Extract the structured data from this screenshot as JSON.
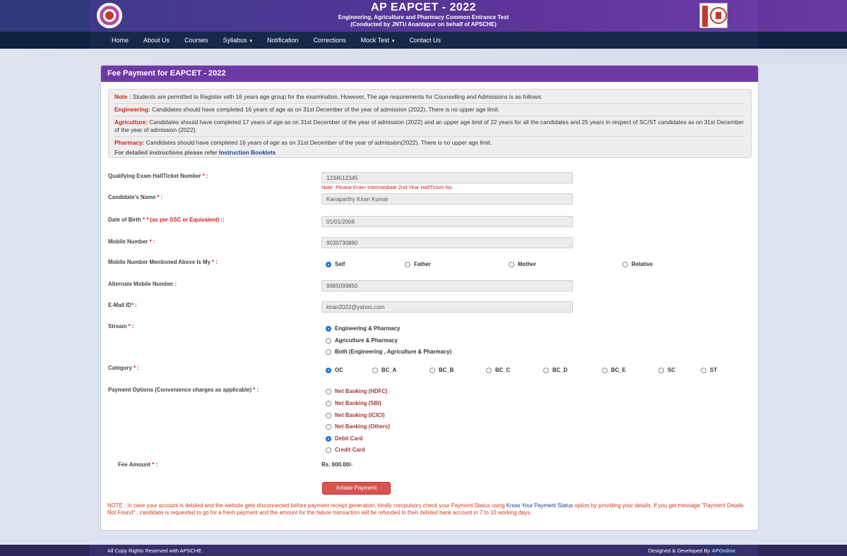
{
  "header": {
    "title": "AP EAPCET - 2022",
    "subtitle1": "Engineering, Agriculture and Pharmacy Common Entrance Test",
    "subtitle2": "(Conducted by JNTU Anantapur on behalf of APSCHE)"
  },
  "nav": {
    "items": [
      "Home",
      "About Us",
      "Courses",
      "Syllabus",
      "Notification",
      "Corrections",
      "Mock Test",
      "Contact Us"
    ]
  },
  "panel": {
    "title": "Fee Payment for EAPCET - 2022"
  },
  "notes": {
    "note_label": "Note :",
    "note_text": " Students are permitted to Register with 16 years age group for the examination. However, The age requirements for Counselling and Admissions is as follows:",
    "eng_label": "Engineering:",
    "eng_text": " Candidates should have completed 16 years of age as on 31st December of the year of admission (2022). There is no upper age limit.",
    "agri_label": "Agriculture:",
    "agri_text": " Candidates should have completed 17 years of age as on 31st December of the year of admission (2022) and an upper age limit of 22 years for all the candidates and 25 years in respect of SC/ST candidates as on 31st December of the year of admission (2022).",
    "pharm_label": "Pharmacy:",
    "pharm_text": " Candidates should have completed 16 years of age as on 31st December of the year of admission(2022). There is no upper age limit.",
    "instr_text": "For detailed instructions please refer ",
    "instr_link": "Instruction Booklets"
  },
  "form": {
    "hallticket_label": "Qualifying Exam HallTicket Number",
    "hallticket_value": "1234512345",
    "hallticket_hint": "Note: Please Enter Intermediate 2nd Year HallTicket No",
    "name_label": "Candidate's Name",
    "name_value": "Kanaparthy Kiran Kumar",
    "dob_label": "Date of Birth",
    "dob_extra": "* (as per SSC or Equivalent)",
    "dob_value": "01/01/2006",
    "mobile_label": "Mobile Number",
    "mobile_value": "9030730880",
    "mobile_owner_label": "Mobile Number Mentioned Above Is My",
    "mobile_owner_options": [
      "Self",
      "Father",
      "Mother",
      "Relative"
    ],
    "alt_mobile_label": "Alternate Mobile Number :",
    "alt_mobile_value": "9985099850",
    "email_label": "E-Mail ID",
    "email_value": "kiran2022@yahoo.com",
    "stream_label": "Stream",
    "stream_options": [
      "Engineering & Pharmacy",
      "Agriculture & Pharmacy",
      "Both (Engineering , Agriculture & Pharmacy)"
    ],
    "category_label": "Category",
    "category_options": [
      "OC",
      "BC_A",
      "BC_B",
      "BC_C",
      "BC_D",
      "BC_E",
      "SC",
      "ST"
    ],
    "payment_label": "Payment Options (Convenience charges as applicable)",
    "payment_options": [
      "Net Banking (HDFC)",
      "Net Banking (SBI)",
      "Net Banking (ICICI)",
      "Net Banking (Others)",
      "Debit Card",
      "Credit Card"
    ],
    "fee_label": "Fee Amount",
    "fee_value": "Rs. 600.00/-",
    "button_label": "Initiate Payment"
  },
  "bottom_note": {
    "part1": "NOTE : In case your account is debited and the website gets disconnected before payment receipt generation, kindly compulsory check your Payment Status using ",
    "link": "Know Your Payment Status",
    "part2": " option by providing your details. If you get message \"Payment Details Not Found\" , candidate is requested to go for a fresh payment and the amount for the failure transaction will be refunded to their debited bank account in 7 to 10 working days."
  },
  "footer": {
    "left": "All Copy Rights Reserved with APSCHE.",
    "right_prefix": "Designed & Developed By ",
    "right_brand": "APOnline"
  }
}
